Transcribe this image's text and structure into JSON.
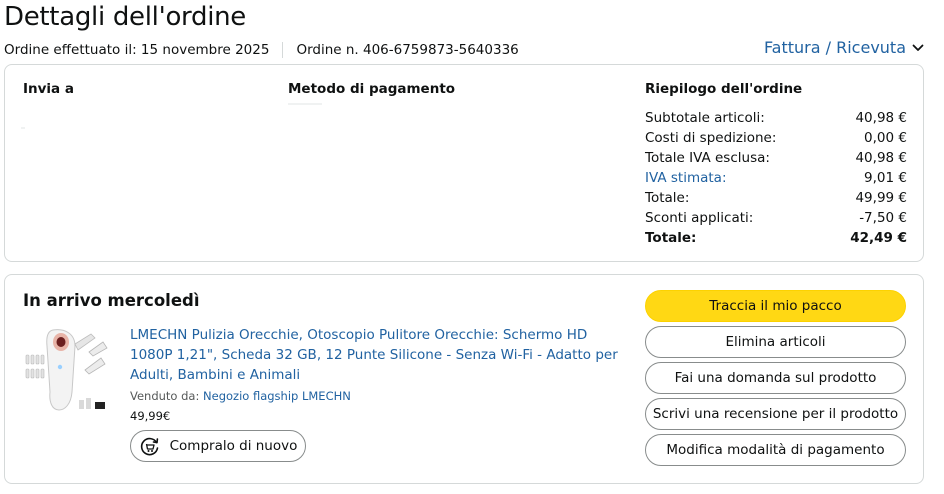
{
  "header": {
    "title": "Dettagli dell'ordine",
    "order_date": "Ordine effettuato il: 15 novembre 2025",
    "order_number": "Ordine n. 406-6759873-5640336",
    "invoice_link": "Fattura / Ricevuta"
  },
  "details": {
    "ship_to_label": "Invia a",
    "payment_label": "Metodo di pagamento",
    "summary_label": "Riepilogo dell'ordine",
    "summary": [
      {
        "label": "Subtotale articoli:",
        "value": "40,98 €"
      },
      {
        "label": "Costi di spedizione:",
        "value": "0,00 €"
      },
      {
        "label": "Totale IVA esclusa:",
        "value": "40,98 €"
      },
      {
        "label": "IVA stimata:",
        "value": "9,01 €"
      },
      {
        "label": "Totale:",
        "value": "49,99 €"
      },
      {
        "label": "Sconti applicati:",
        "value": "-7,50 €"
      },
      {
        "label": "Totale:",
        "value": "42,49 €"
      }
    ]
  },
  "shipment": {
    "arrival": "In arrivo mercoledì",
    "product_title": "LMECHN Pulizia Orecchie, Otoscopio Pulitore Orecchie: Schermo HD 1080P 1,21\", Scheda 32 GB, 12 Punte Silicone - Senza Wi-Fi - Adatto per Adulti, Bambini e Animali",
    "sold_by_label": "Venduto da:",
    "seller": "Negozio flagship LMECHN",
    "price": "49,99€",
    "buy_again": "Compralo di nuovo",
    "actions": [
      "Traccia il mio pacco",
      "Elimina articoli",
      "Fai una domanda sul prodotto",
      "Scrivi una recensione per il prodotto",
      "Modifica modalità di pagamento"
    ]
  },
  "colors": {
    "link": "#2162a1",
    "primary_button": "#ffd814",
    "border": "#d5d9d9"
  },
  "icons": {
    "invoice_chevron": "chevron-down-icon",
    "buy_again": "buy-again-icon"
  }
}
